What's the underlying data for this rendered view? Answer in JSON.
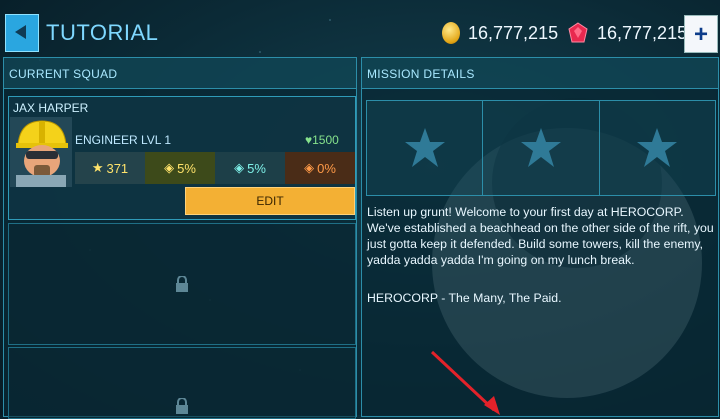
{
  "header": {
    "title": "TUTORIAL",
    "coins": "16,777,215",
    "gems": "16,777,215"
  },
  "squad": {
    "heading": "CURRENT SQUAD",
    "hero": {
      "name": "JAX HARPER",
      "class_level": "ENGINEER LVL 1",
      "power": "1500",
      "stats": [
        "371",
        "5%",
        "5%",
        "0%"
      ],
      "edit_label": "EDIT"
    }
  },
  "mission": {
    "heading": "MISSION DETAILS",
    "stars_earned": 0,
    "stars_total": 3,
    "description": "Listen up grunt! Welcome to your first day at HEROCORP. We've established a beachhead on the other side of the rift, you just gotta keep it defended. Build some towers, kill the enemy, yadda yadda yadda I'm going on my lunch break.",
    "signature": "HEROCORP - The Many, The Paid."
  },
  "colors": {
    "accent": "#2aa6e0",
    "edit_button": "#f3b034",
    "panel_border": "#2c8ea9",
    "power_green": "#86e28c"
  }
}
